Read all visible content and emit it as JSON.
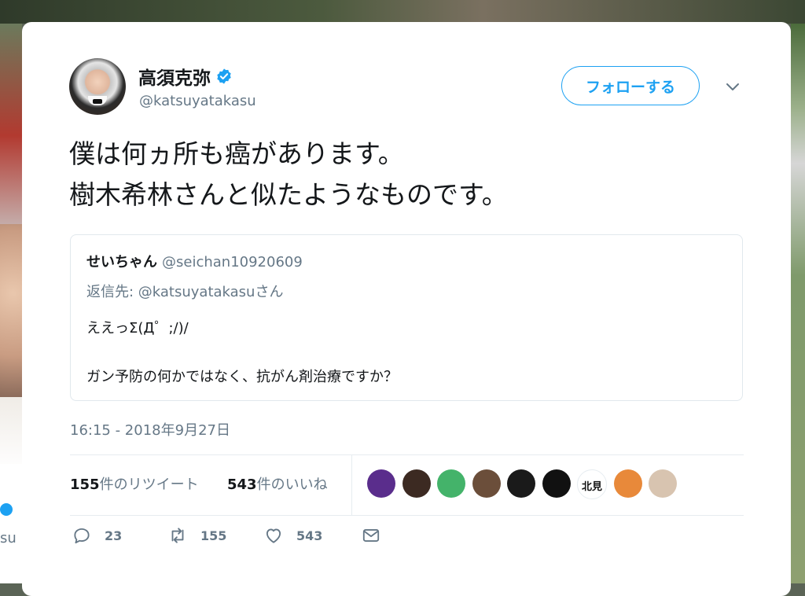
{
  "tweet": {
    "display_name": "高須克弥",
    "handle": "@katsuyatakasu",
    "follow_label": "フォローする",
    "text_lines": [
      "僕は何ヵ所も癌があります。",
      "樹木希林さんと似たようなものです。"
    ],
    "timestamp": "16:15 - 2018年9月27日"
  },
  "quote": {
    "name": "せいちゃん",
    "handle": "@seichan10920609",
    "reply_to": "返信先: @katsuyatakasuさん",
    "line1": "ええっΣ(Д゜;/)/",
    "line2": "ガン予防の何かではなく、抗がん剤治療ですか？"
  },
  "stats": {
    "retweets_count": "155",
    "retweets_label": "件のリツイート",
    "likes_count": "543",
    "likes_label": "件のいいね"
  },
  "likers": [
    {
      "name": "liker-1",
      "color": "#5a2d8c"
    },
    {
      "name": "liker-2",
      "color": "#3c2a22"
    },
    {
      "name": "liker-3",
      "color": "#44b36a"
    },
    {
      "name": "liker-4",
      "color": "#6b4e3a"
    },
    {
      "name": "liker-5",
      "color": "#1a1a1a"
    },
    {
      "name": "liker-6",
      "color": "#111111"
    },
    {
      "name": "liker-7",
      "color": "#ffffff",
      "text": "北見"
    },
    {
      "name": "liker-8",
      "color": "#e8893a"
    },
    {
      "name": "liker-9",
      "color": "#d8c4b0"
    }
  ],
  "actions": {
    "reply_count": "23",
    "retweet_count": "155",
    "like_count": "543"
  },
  "background": {
    "left_text": "su"
  },
  "colors": {
    "accent": "#1da1f2",
    "secondary_text": "#657786",
    "primary_text": "#14171a"
  }
}
